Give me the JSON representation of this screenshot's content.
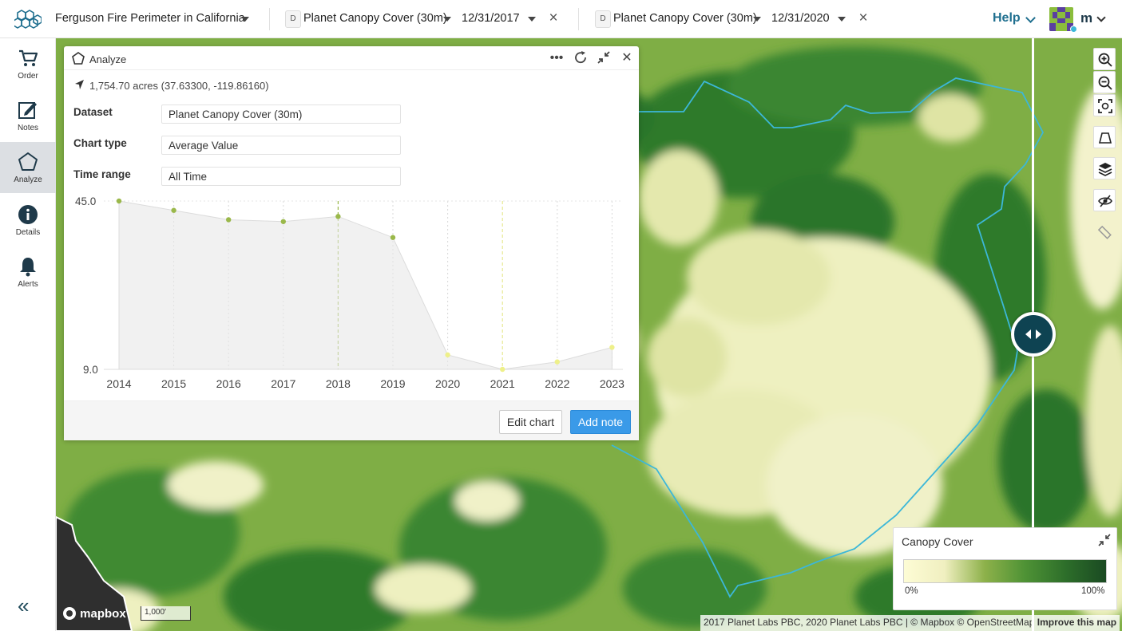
{
  "header": {
    "project_title": "Ferguson Fire Perimeter in California",
    "layer_left": {
      "badge": "D",
      "name": "Planet Canopy Cover (30m)",
      "date": "12/31/2017"
    },
    "layer_right": {
      "badge": "D",
      "name": "Planet Canopy Cover (30m)",
      "date": "12/31/2020"
    },
    "help_label": "Help",
    "user_initial": "m"
  },
  "sidebar": {
    "items": [
      {
        "label": "Order",
        "icon": "cart-icon"
      },
      {
        "label": "Notes",
        "icon": "edit-icon"
      },
      {
        "label": "Analyze",
        "icon": "pentagon-icon",
        "active": true
      },
      {
        "label": "Details",
        "icon": "info-icon"
      },
      {
        "label": "Alerts",
        "icon": "bell-icon"
      }
    ],
    "collapse_label": "«"
  },
  "analyze_panel": {
    "title": "Analyze",
    "area_summary": "1,754.70 acres (37.63300, -119.86160)",
    "fields": {
      "dataset_label": "Dataset",
      "dataset_value": "Planet Canopy Cover (30m)",
      "chart_type_label": "Chart type",
      "chart_type_value": "Average Value",
      "time_range_label": "Time range",
      "time_range_value": "All Time"
    },
    "edit_chart_label": "Edit chart",
    "add_note_label": "Add note"
  },
  "chart_data": {
    "type": "area",
    "categories": [
      "2014",
      "2015",
      "2016",
      "2017",
      "2018",
      "2019",
      "2020",
      "2021",
      "2022",
      "2023"
    ],
    "values": [
      45.0,
      43.0,
      41.0,
      40.6,
      41.7,
      37.2,
      12.1,
      9.0,
      10.6,
      13.7
    ],
    "ylim": [
      9.0,
      45.0
    ],
    "y_tick_labels": [
      "45.0",
      "9.0"
    ],
    "highlighted_years": [
      "2018",
      "2021"
    ],
    "colors": {
      "point_early": "#9ab84a",
      "point_late": "#eef08a",
      "area": "#e8e8e8"
    }
  },
  "legend": {
    "title": "Canopy Cover",
    "min_label": "0%",
    "max_label": "100%"
  },
  "map_footer": {
    "mapbox_label": "mapbox",
    "scale_label": "1,000′",
    "attribution": "2017 Planet Labs PBC, 2020 Planet Labs PBC | © Mapbox © OpenStreetMap",
    "improve_label": "Improve this map"
  },
  "colors": {
    "accent": "#3a9ae8",
    "help": "#1f6f8f",
    "perimeter": "#3cb7d8",
    "swipe_handle": "#0e4352"
  }
}
